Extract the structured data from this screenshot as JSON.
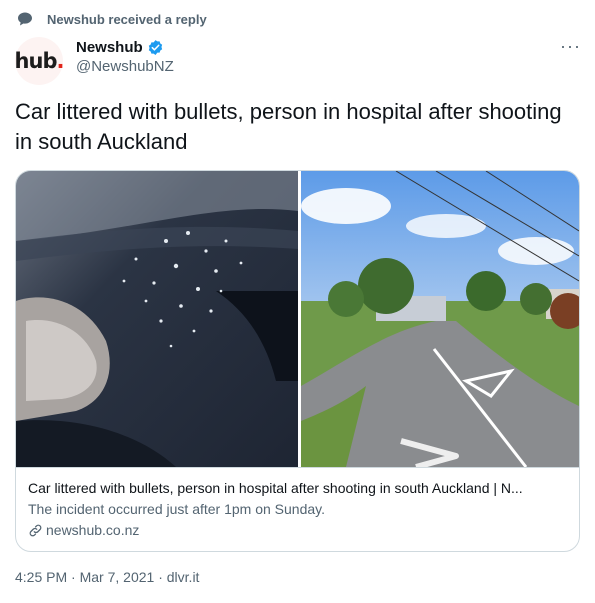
{
  "context": {
    "icon": "speech-bubble-icon",
    "text": "Newshub received a reply"
  },
  "author": {
    "avatar_text": "hub",
    "avatar_dot": ".",
    "name": "Newshub",
    "verified_icon": "verified-badge-icon",
    "handle": "@NewshubNZ"
  },
  "more_label": "···",
  "tweet": {
    "text": "Car littered with bullets, person in hospital after shooting in south Auckland"
  },
  "card": {
    "title": "Car littered with bullets, person in hospital after shooting in south Auckland | N...",
    "description": "The incident occurred just after 1pm on Sunday.",
    "domain_icon": "link-icon",
    "domain": "newshub.co.nz"
  },
  "meta": {
    "time": "4:25 PM",
    "sep": " · ",
    "date": "Mar 7, 2021",
    "source": "dlvr.it"
  },
  "colors": {
    "text": "#0f1419",
    "muted": "#536471",
    "border": "#cfd9de",
    "verified": "#1d9bf0",
    "brand_dot": "#e1251b"
  }
}
